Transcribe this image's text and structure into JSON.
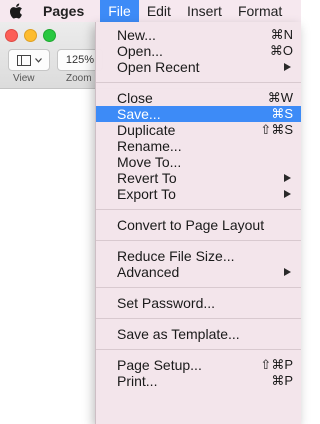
{
  "menubar": {
    "app_name": "Pages",
    "items": [
      "File",
      "Edit",
      "Insert",
      "Format"
    ]
  },
  "toolbar": {
    "zoom_value": "125%",
    "view_label": "View",
    "zoom_label": "Zoom"
  },
  "file_menu": {
    "groups": [
      [
        {
          "label": "New...",
          "shortcut": "⌘N"
        },
        {
          "label": "Open...",
          "shortcut": "⌘O"
        },
        {
          "label": "Open Recent",
          "shortcut": "",
          "submenu": true
        }
      ],
      [
        {
          "label": "Close",
          "shortcut": "⌘W"
        },
        {
          "label": "Save...",
          "shortcut": "⌘S",
          "selected": true
        },
        {
          "label": "Duplicate",
          "shortcut": "⇧⌘S"
        },
        {
          "label": "Rename...",
          "shortcut": ""
        },
        {
          "label": "Move To...",
          "shortcut": ""
        },
        {
          "label": "Revert To",
          "shortcut": "",
          "submenu": true
        },
        {
          "label": "Export To",
          "shortcut": "",
          "submenu": true
        }
      ],
      [
        {
          "label": "Convert to Page Layout",
          "shortcut": ""
        }
      ],
      [
        {
          "label": "Reduce File Size...",
          "shortcut": ""
        },
        {
          "label": "Advanced",
          "shortcut": "",
          "submenu": true
        }
      ],
      [
        {
          "label": "Set Password...",
          "shortcut": ""
        }
      ],
      [
        {
          "label": "Save as Template...",
          "shortcut": ""
        }
      ],
      [
        {
          "label": "Page Setup...",
          "shortcut": "⇧⌘P"
        },
        {
          "label": "Print...",
          "shortcut": "⌘P"
        }
      ]
    ]
  }
}
